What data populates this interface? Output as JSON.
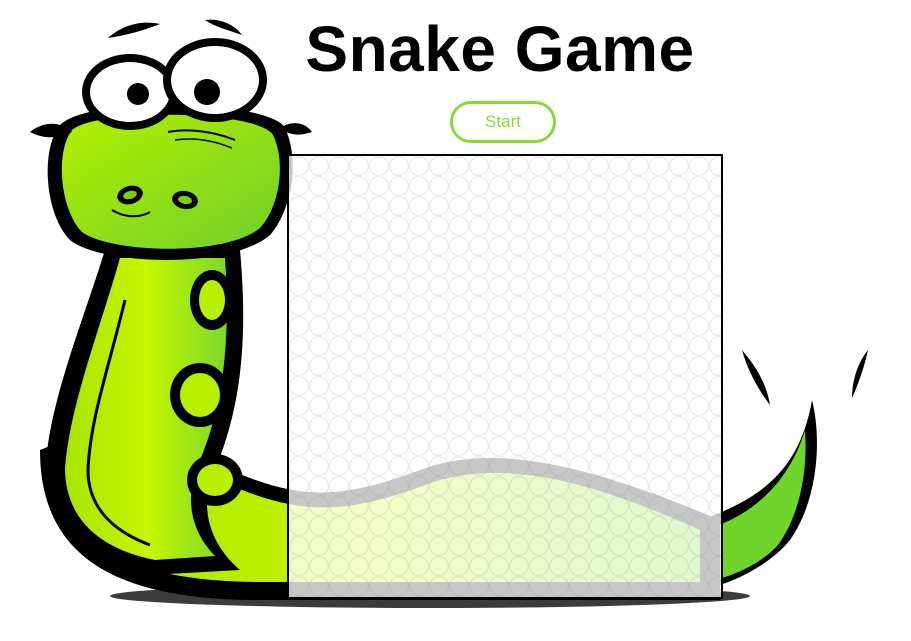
{
  "page": {
    "title": "Snake Game"
  },
  "controls": {
    "start_label": "Start"
  },
  "colors": {
    "accent": "#8bd63a",
    "snake_green_light": "#c8f000",
    "snake_green_dark": "#66d022",
    "outline": "#000000",
    "board_border": "#000000"
  },
  "icons": {
    "mascot": "snake-mascot-icon"
  }
}
